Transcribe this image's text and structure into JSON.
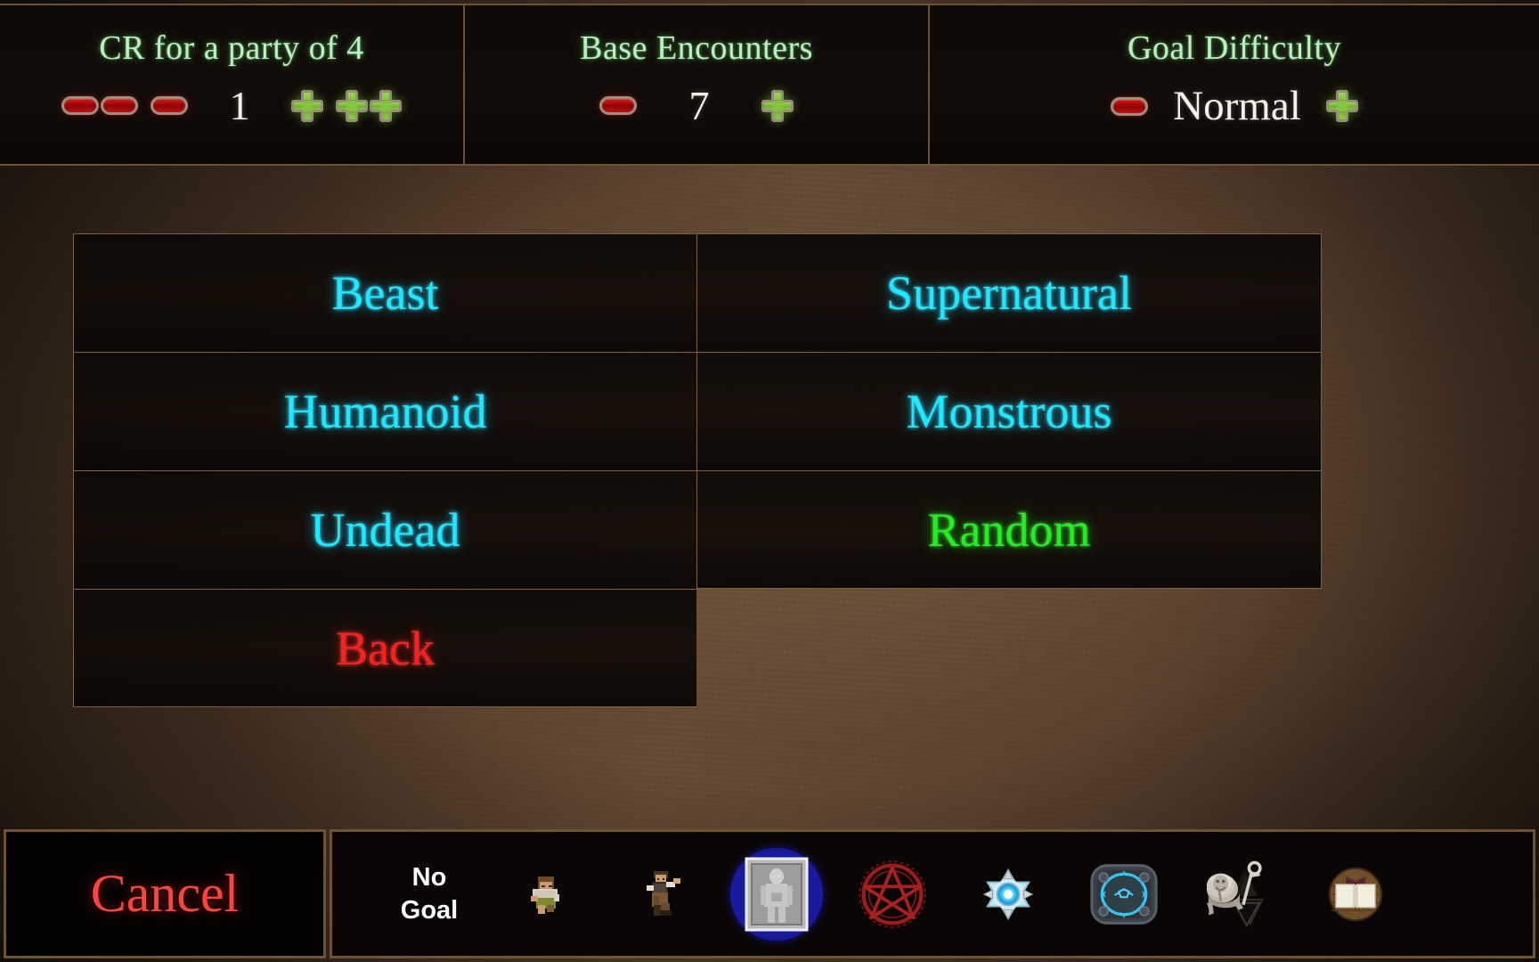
{
  "top_stats": [
    {
      "id": "cr-party",
      "title": "CR for a party of 4",
      "value": "1",
      "decrements": [
        "minus-double",
        "minus-single"
      ],
      "increments": [
        "plus-single",
        "plus-double"
      ]
    },
    {
      "id": "base-encounters",
      "title": "Base Encounters",
      "value": "7",
      "decrements": [
        "minus-single"
      ],
      "increments": [
        "plus-single"
      ]
    },
    {
      "id": "goal-difficulty",
      "title": "Goal Difficulty",
      "value": "Normal",
      "decrements": [
        "minus-single"
      ],
      "increments": [
        "plus-single"
      ]
    }
  ],
  "menu": {
    "rows": [
      [
        {
          "label": "Beast",
          "style": "cyan"
        },
        {
          "label": "Supernatural",
          "style": "cyan"
        }
      ],
      [
        {
          "label": "Humanoid",
          "style": "cyan"
        },
        {
          "label": "Monstrous",
          "style": "cyan"
        }
      ],
      [
        {
          "label": "Undead",
          "style": "cyan"
        },
        {
          "label": "Random",
          "style": "green"
        }
      ],
      [
        {
          "label": "Back",
          "style": "red"
        },
        {
          "label": "",
          "style": "empty"
        }
      ]
    ]
  },
  "bottom": {
    "cancel_label": "Cancel",
    "no_goal_label": "No\nGoal",
    "goal_icons": [
      {
        "name": "crouching-peasant-icon",
        "selected": false
      },
      {
        "name": "gesturing-villager-icon",
        "selected": false
      },
      {
        "name": "stone-statue-tablet-icon",
        "selected": true
      },
      {
        "name": "red-pentagram-summoning-circle-icon",
        "selected": false
      },
      {
        "name": "blue-glowing-crystal-star-icon",
        "selected": false
      },
      {
        "name": "blue-ringed-portal-platform-icon",
        "selected": false
      },
      {
        "name": "gargoyle-statue-with-ankh-staff-icon",
        "selected": false
      },
      {
        "name": "open-book-icon",
        "selected": false
      }
    ]
  },
  "colors": {
    "title_green": "#b9f2bd",
    "value_white": "#f3f1ea",
    "menu_cyan": "#1ce9ff",
    "menu_green": "#22ee22",
    "menu_red": "#ff1f1f",
    "cancel_red": "#f9463f",
    "frame_brown": "#6d5335",
    "selected_blue": "#1a1a9e",
    "minus_red": "#c01010",
    "plus_green": "#8cc848"
  }
}
